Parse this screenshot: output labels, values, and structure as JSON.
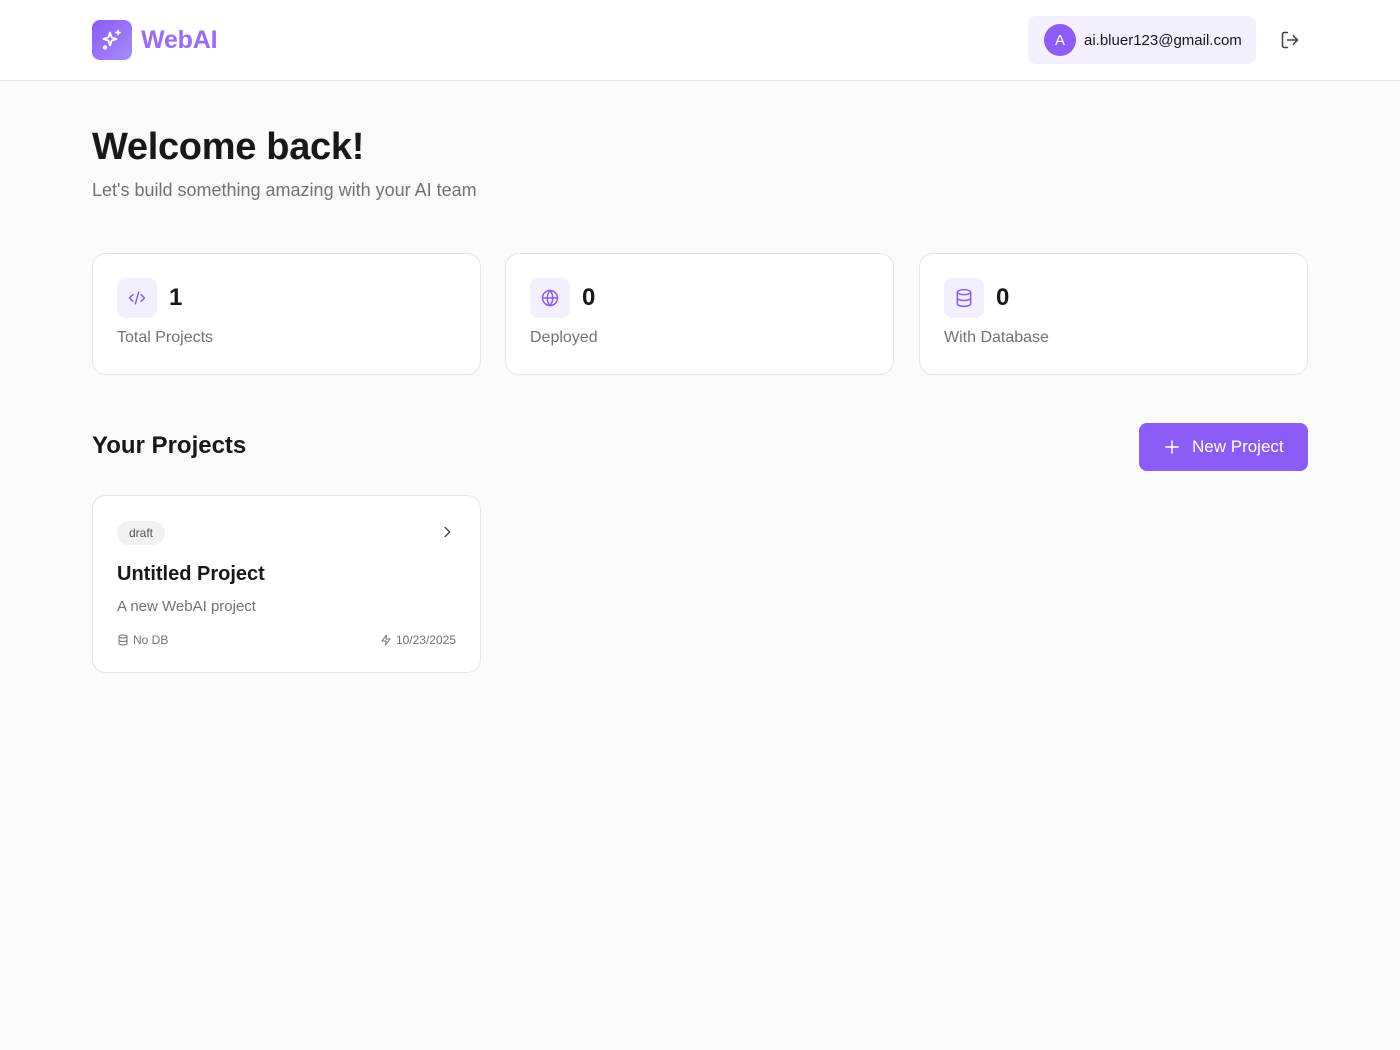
{
  "brand": {
    "name": "WebAI",
    "icon": "sparkles-icon",
    "accent": "#8b5cf6"
  },
  "user": {
    "avatar_letter": "A",
    "email": "ai.bluer123@gmail.com",
    "logout_icon": "logout-icon"
  },
  "welcome": {
    "title": "Welcome back!",
    "subtitle": "Let's build something amazing with your AI team"
  },
  "stats": [
    {
      "icon": "code-icon",
      "value": "1",
      "label": "Total Projects"
    },
    {
      "icon": "globe-icon",
      "value": "0",
      "label": "Deployed"
    },
    {
      "icon": "database-icon",
      "value": "0",
      "label": "With Database"
    }
  ],
  "projects_section": {
    "title": "Your Projects",
    "new_project_label": "New Project"
  },
  "projects": [
    {
      "status": "draft",
      "name": "Untitled Project",
      "description": "A new WebAI project",
      "db": "No DB",
      "date": "10/23/2025"
    }
  ]
}
